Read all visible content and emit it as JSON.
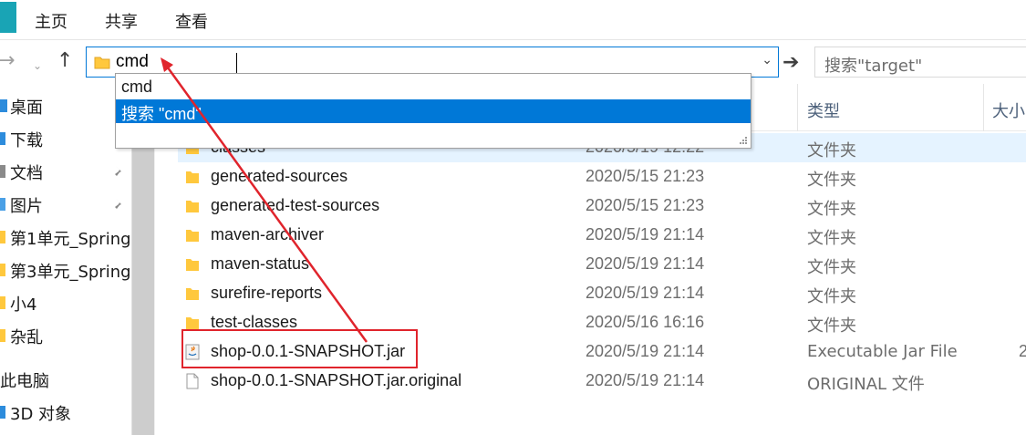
{
  "ribbon": {
    "tabs": [
      "主页",
      "共享",
      "查看"
    ]
  },
  "address_bar": {
    "value": "cmd",
    "search_placeholder": "搜索\"target\""
  },
  "autocomplete": {
    "items": [
      "cmd",
      "搜索 \"cmd\""
    ]
  },
  "sidebar": {
    "items": [
      {
        "label": "桌面",
        "icon": "desktop-icon",
        "pinned": true
      },
      {
        "label": "下载",
        "icon": "download-icon",
        "pinned": true
      },
      {
        "label": "文档",
        "icon": "document-icon",
        "pinned": true
      },
      {
        "label": "图片",
        "icon": "picture-icon",
        "pinned": true
      },
      {
        "label": "第1单元_Spring",
        "icon": "folder-icon",
        "pinned": false
      },
      {
        "label": "第3单元_Spring",
        "icon": "folder-icon",
        "pinned": false
      },
      {
        "label": "小4",
        "icon": "folder-icon",
        "pinned": false
      },
      {
        "label": "杂乱",
        "icon": "folder-icon",
        "pinned": false
      },
      {
        "label": "此电脑",
        "icon": "computer-icon",
        "pinned": false
      },
      {
        "label": "3D 对象",
        "icon": "3d-objects-icon",
        "pinned": false
      }
    ]
  },
  "columns": {
    "type": "类型",
    "size": "大小"
  },
  "files": [
    {
      "name": "classes",
      "date": "2020/5/19 12:22",
      "type": "文件夹",
      "size": "",
      "icon": "folder-icon"
    },
    {
      "name": "generated-sources",
      "date": "2020/5/15 21:23",
      "type": "文件夹",
      "size": "",
      "icon": "folder-icon"
    },
    {
      "name": "generated-test-sources",
      "date": "2020/5/15 21:23",
      "type": "文件夹",
      "size": "",
      "icon": "folder-icon"
    },
    {
      "name": "maven-archiver",
      "date": "2020/5/19 21:14",
      "type": "文件夹",
      "size": "",
      "icon": "folder-icon"
    },
    {
      "name": "maven-status",
      "date": "2020/5/19 21:14",
      "type": "文件夹",
      "size": "",
      "icon": "folder-icon"
    },
    {
      "name": "surefire-reports",
      "date": "2020/5/19 21:14",
      "type": "文件夹",
      "size": "",
      "icon": "folder-icon"
    },
    {
      "name": "test-classes",
      "date": "2020/5/16 16:16",
      "type": "文件夹",
      "size": "",
      "icon": "folder-icon"
    },
    {
      "name": "shop-0.0.1-SNAPSHOT.jar",
      "date": "2020/5/19 21:14",
      "type": "Executable Jar File",
      "size": "2",
      "icon": "java-jar-icon"
    },
    {
      "name": "shop-0.0.1-SNAPSHOT.jar.original",
      "date": "2020/5/19 21:14",
      "type": "ORIGINAL 文件",
      "size": "",
      "icon": "file-icon"
    }
  ],
  "colors": {
    "accent": "#0078d7",
    "annotation": "#e0242c",
    "folder": "#ffc83d"
  }
}
